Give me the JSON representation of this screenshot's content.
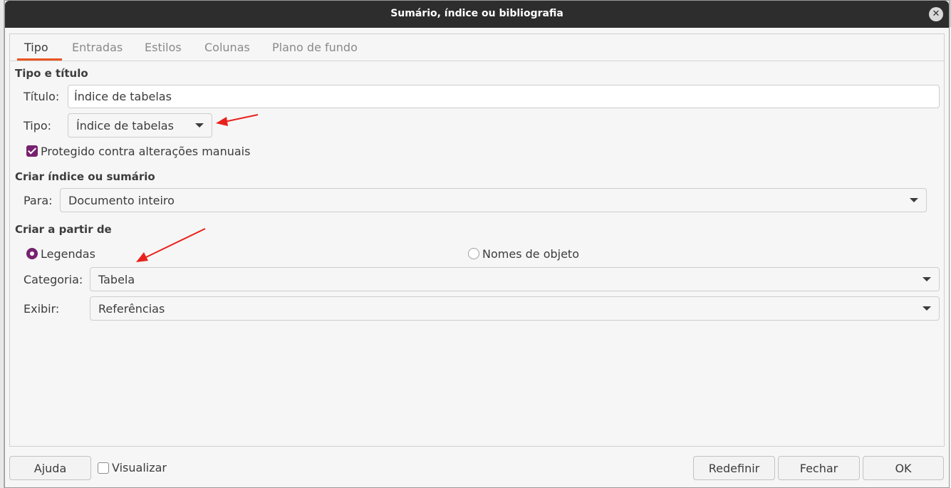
{
  "window": {
    "title": "Sumário, índice ou bibliografia"
  },
  "tabs": [
    {
      "label": "Tipo",
      "active": true
    },
    {
      "label": "Entradas"
    },
    {
      "label": "Estilos"
    },
    {
      "label": "Colunas"
    },
    {
      "label": "Plano de fundo"
    }
  ],
  "type_title": {
    "heading": "Tipo e título",
    "title_label": "Título:",
    "title_value": "Índice de tabelas",
    "type_label": "Tipo:",
    "type_value": "Índice de tabelas",
    "protected_label": "Protegido contra alterações manuais",
    "protected_checked": true
  },
  "create_index": {
    "heading": "Criar índice ou sumário",
    "for_label": "Para:",
    "for_value": "Documento inteiro"
  },
  "create_from": {
    "heading": "Criar a partir de",
    "captions_label": "Legendas",
    "object_names_label": "Nomes de objeto",
    "selected": "Legendas",
    "category_label": "Categoria:",
    "category_value": "Tabela",
    "display_label": "Exibir:",
    "display_value": "Referências"
  },
  "footer": {
    "help": "Ajuda",
    "preview_label": "Visualizar",
    "preview_checked": false,
    "reset": "Redefinir",
    "close": "Fechar",
    "ok": "OK"
  },
  "colors": {
    "accent": "#e95420",
    "check_purple": "#77216f",
    "annotation_arrow": "#e8221b",
    "titlebar": "#2d2d2d"
  }
}
